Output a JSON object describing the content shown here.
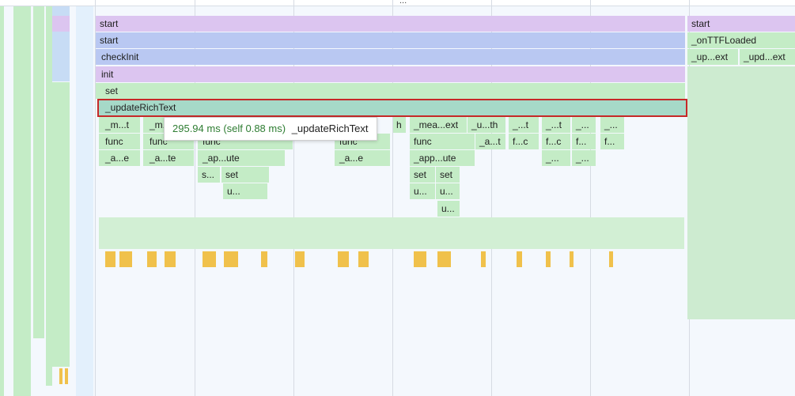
{
  "header": {
    "ellipsis": "..."
  },
  "flame": {
    "left_stack": [
      {
        "label": "start"
      },
      {
        "label": "start"
      },
      {
        "label": "checkInit"
      },
      {
        "label": "init"
      },
      {
        "label": "set"
      },
      {
        "label": "_updateRichText"
      }
    ],
    "right_stack": {
      "row1": "start",
      "row2": "_onTTFLoaded",
      "row3a": "_up...ext",
      "row3b": "_upd...ext"
    },
    "row7": [
      "_m...t",
      "_m...",
      "h",
      "_mea...ext",
      "_u...th",
      "_...t",
      "_...t",
      "_...",
      "_..."
    ],
    "row8": [
      "func",
      "func",
      "func",
      "func",
      "func",
      "_a...t",
      "f...c",
      "f...c",
      "f...",
      "f..."
    ],
    "row9": [
      "_a...e",
      "_a...te",
      "_ap...ute",
      "_a...e",
      "_app...ute",
      "_...",
      "_..."
    ],
    "row10": [
      "s...",
      "set",
      "set",
      "set"
    ],
    "row11": [
      "u...",
      "u...",
      "u..."
    ],
    "row12": [
      "u..."
    ]
  },
  "tooltip": {
    "duration": "295.94 ms (self 0.88 ms)",
    "name": "_updateRichText"
  },
  "colors": {
    "purple": "#dcc5f0",
    "blue": "#b9c8f2",
    "green": "#c4ecc6",
    "selected_teal": "#a6d9c8",
    "yellow": "#f0c14b",
    "selection_border": "#c62828",
    "tooltip_duration": "#2e7d32"
  }
}
